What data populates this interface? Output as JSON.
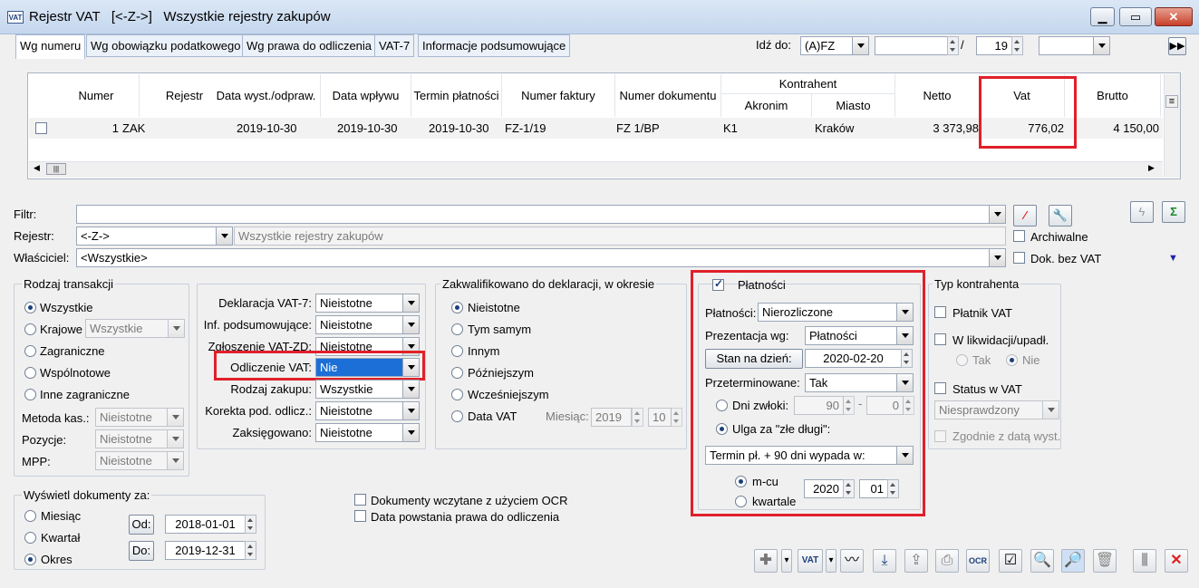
{
  "window": {
    "title": "Rejestr VAT   [<-Z->]   Wszystkie rejestry zakupów",
    "app_icon": "VAT"
  },
  "tabs": [
    "Wg numeru",
    "Wg obowiązku podatkowego",
    "Wg prawa do odliczenia",
    "VAT-7",
    "Informacje podsumowujące"
  ],
  "goto": {
    "label": "Idź do:",
    "field": "(A)FZ",
    "sep": "/",
    "number": "19"
  },
  "table": {
    "headers": {
      "numer": "Numer",
      "rejestr": "Rejestr",
      "data_wyst": "Data wyst./odpraw.",
      "data_wplywu": "Data wpływu",
      "termin": "Termin płatności",
      "faktura": "Numer faktury",
      "dokument": "Numer dokumentu",
      "kontrahent": "Kontrahent",
      "akronim": "Akronim",
      "miasto": "Miasto",
      "netto": "Netto",
      "vat": "Vat",
      "brutto": "Brutto"
    },
    "row": {
      "numer": "1",
      "rejestr": "ZAK",
      "data_wyst": "2019-10-30",
      "data_wplywu": "2019-10-30",
      "termin": "2019-10-30",
      "faktura": "FZ-1/19",
      "dokument": "FZ 1/BP",
      "akronim": "K1",
      "miasto": "Kraków",
      "netto": "3 373,98",
      "vat": "776,02",
      "brutto": "4 150,00"
    }
  },
  "filters": {
    "filtr_label": "Filtr:",
    "rejestr_label": "Rejestr:",
    "rejestr_value": "<-Z->",
    "rejestr_desc": "Wszystkie rejestry zakupów",
    "wlasciciel_label": "Właściciel:",
    "wlasciciel_value": "<Wszystkie>",
    "archiwalne": "Archiwalne",
    "dok_bez_vat": "Dok. bez VAT"
  },
  "rodzaj": {
    "title": "Rodzaj transakcji",
    "wszystkie": "Wszystkie",
    "krajowe": "Krajowe",
    "krajowe_value": "Wszystkie",
    "zagraniczne": "Zagraniczne",
    "wspolnotowe": "Wspólnotowe",
    "inne": "Inne zagraniczne",
    "metoda_label": "Metoda kas.:",
    "metoda_value": "Nieistotne",
    "pozycje_label": "Pozycje:",
    "pozycje_value": "Nieistotne",
    "mpp_label": "MPP:",
    "mpp_value": "Nieistotne"
  },
  "deklaracje": {
    "deklaracja_label": "Deklaracja VAT-7:",
    "deklaracja_value": "Nieistotne",
    "inf_label": "Inf. podsumowujące:",
    "inf_value": "Nieistotne",
    "zgloszenie_label": "Zgłoszenie VAT-ZD:",
    "zgloszenie_value": "Nieistotne",
    "odliczenie_label": "Odliczenie VAT:",
    "odliczenie_value": "Nie",
    "rodzaj_label": "Rodzaj zakupu:",
    "rodzaj_value": "Wszystkie",
    "korekta_label": "Korekta pod. odlicz.:",
    "korekta_value": "Nieistotne",
    "zaksieg_label": "Zaksięgowano:",
    "zaksieg_value": "Nieistotne"
  },
  "zakwal": {
    "title": "Zakwalifikowano do deklaracji, w okresie",
    "nieistotne": "Nieistotne",
    "tym": "Tym samym",
    "innym": "Innym",
    "pozn": "Późniejszym",
    "wczes": "Wcześniejszym",
    "data": "Data VAT",
    "miesiac_label": "Miesiąc:",
    "rok": "2019",
    "mies": "10"
  },
  "platnosci": {
    "title": "Płatności",
    "platnosci_label": "Płatności:",
    "platnosci_value": "Nierozliczone",
    "prez_label": "Prezentacja wg:",
    "prez_value": "Płatności",
    "stan_button": "Stan na dzień:",
    "stan_date": "2020-02-20",
    "przet_label": "Przeterminowane:",
    "przet_value": "Tak",
    "dni_label": "Dni zwłoki:",
    "dni_from": "90",
    "dash": "-",
    "dni_to": "0",
    "ulga_label": "Ulga za \"złe długi\":",
    "termin_value": "Termin pł. + 90 dni wypada w:",
    "mcu": "m-cu",
    "kwartale": "kwartale",
    "rok": "2020",
    "mies": "01"
  },
  "typ": {
    "title": "Typ kontrahenta",
    "platnik": "Płatnik VAT",
    "likwid": "W likwidacji/upadł.",
    "tak": "Tak",
    "nie": "Nie",
    "status": "Status w VAT",
    "status_value": "Niesprawdzony",
    "zgodnie": "Zgodnie z datą wyst."
  },
  "wyswietl": {
    "title": "Wyświetl dokumenty za:",
    "miesiac": "Miesiąc",
    "kwartal": "Kwartał",
    "okres": "Okres",
    "od_button": "Od:",
    "od_date": "2018-01-01",
    "do_button": "Do:",
    "do_date": "2019-12-31"
  },
  "ocr": {
    "ocr_label": "Dokumenty wczytane z użyciem OCR",
    "data_label": "Data powstania prawa do odliczenia"
  },
  "toolbar": {
    "ocr_text": "OCR",
    "vat_text": "VAT"
  }
}
